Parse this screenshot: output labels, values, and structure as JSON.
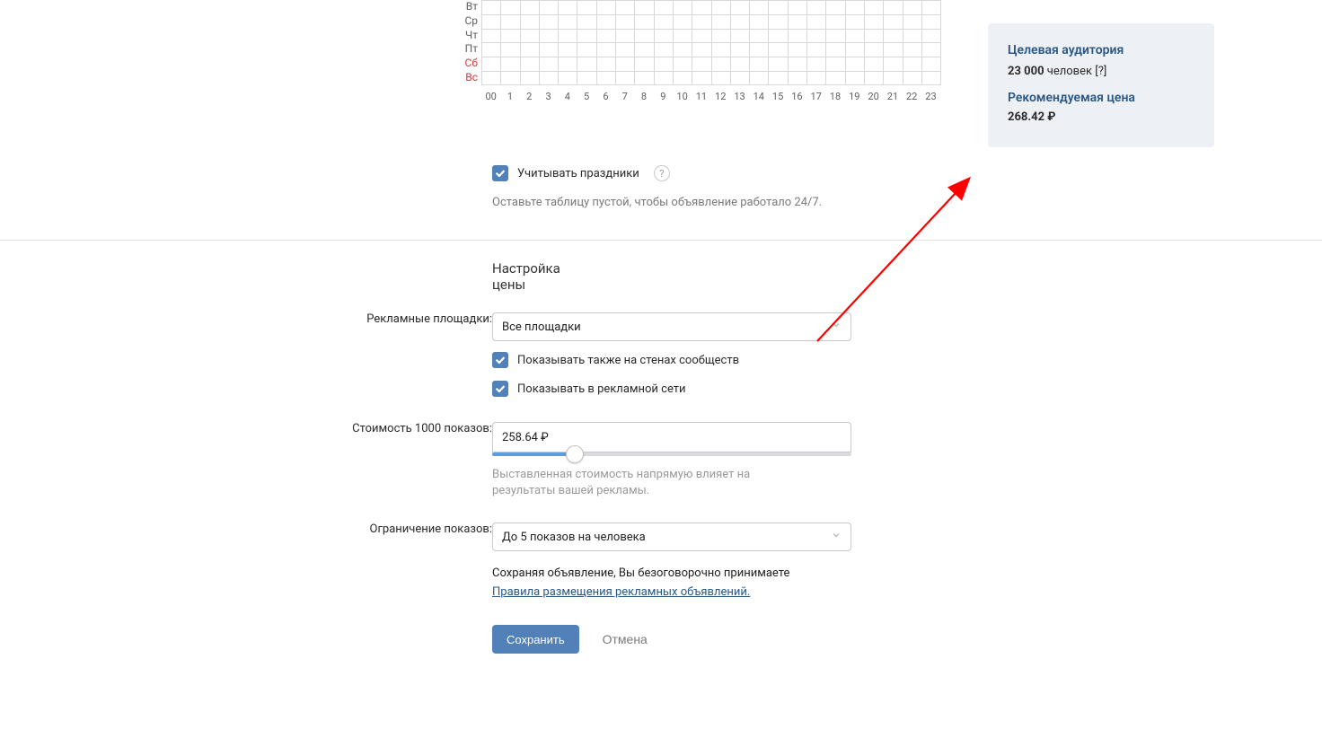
{
  "sidebar": {
    "audience_title": "Целевая аудитория",
    "audience_value": "23 000",
    "audience_unit": "человек",
    "audience_q": "[?]",
    "price_title": "Рекомендуемая цена",
    "price_value": "268.42 ₽"
  },
  "schedule": {
    "days": [
      "Вт",
      "Ср",
      "Чт",
      "Пт",
      "Сб",
      "Вс"
    ],
    "weekend_indices": [
      4,
      5
    ],
    "hours": [
      "00",
      "1",
      "2",
      "3",
      "4",
      "5",
      "6",
      "7",
      "8",
      "9",
      "10",
      "11",
      "12",
      "13",
      "14",
      "15",
      "16",
      "17",
      "18",
      "19",
      "20",
      "21",
      "22",
      "23"
    ],
    "holidays_checkbox": "Учитывать праздники",
    "holidays_help": "?",
    "hint": "Оставьте таблицу пустой, чтобы объявление работало 24/7."
  },
  "pricing": {
    "heading": "Настройка цены",
    "platforms_label": "Рекламные площадки:",
    "platforms_value": "Все площадки",
    "walls_checkbox": "Показывать также на стенах сообществ",
    "network_checkbox": "Показывать в рекламной сети",
    "cpm_label": "Стоимость 1000 показов:",
    "cpm_value": "258.64 ₽",
    "cpm_slider_pct": 23,
    "cpm_hint": "Выставленная стоимость напрямую влияет на результаты вашей рекламы.",
    "limit_label": "Ограничение показов:",
    "limit_value": "До 5 показов на человека",
    "accept_text": "Сохраняя объявление, Вы безоговорочно принимаете",
    "rules_link": "Правила размещения рекламных объявлений.",
    "save_btn": "Сохранить",
    "cancel_btn": "Отмена"
  }
}
